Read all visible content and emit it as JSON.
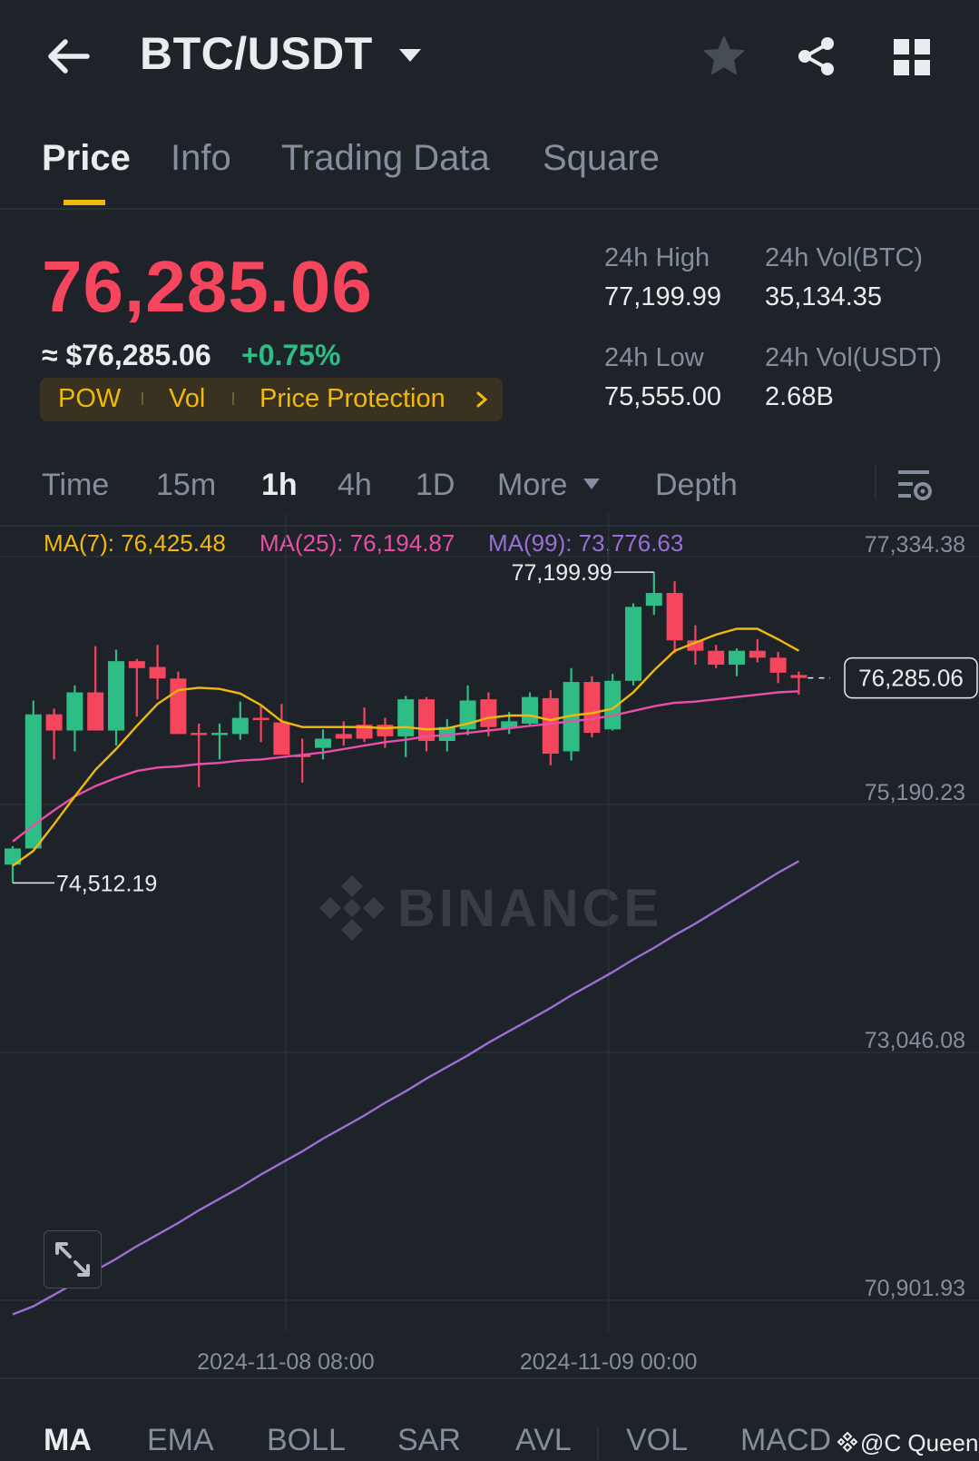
{
  "header": {
    "pair": "BTC/USDT",
    "icons": [
      "back-arrow-icon",
      "caret-down-icon",
      "star-icon",
      "share-icon",
      "grid-icon"
    ]
  },
  "tabs": [
    {
      "label": "Price",
      "active": true
    },
    {
      "label": "Info",
      "active": false
    },
    {
      "label": "Trading Data",
      "active": false
    },
    {
      "label": "Square",
      "active": false
    }
  ],
  "ticker": {
    "last_price": "76,285.06",
    "approx_usd": "≈ $76,285.06",
    "change_pct": "+0.75%",
    "tags": [
      "POW",
      "Vol",
      "Price Protection"
    ],
    "stats": {
      "high_label": "24h High",
      "high_value": "77,199.99",
      "low_label": "24h Low",
      "low_value": "75,555.00",
      "vol_btc_label": "24h Vol(BTC)",
      "vol_btc_value": "35,134.35",
      "vol_usdt_label": "24h Vol(USDT)",
      "vol_usdt_value": "2.68B"
    }
  },
  "intervals": {
    "items": [
      "Time",
      "15m",
      "1h",
      "4h",
      "1D",
      "More",
      "Depth"
    ],
    "active": "1h"
  },
  "ma_legend": {
    "ma7": "MA(7): 76,425.48",
    "ma25": "MA(25): 76,194.87",
    "ma99": "MA(99): 73,776.63"
  },
  "chart": {
    "watermark": "BINANCE",
    "expand_icon": "expand-arrows-icon",
    "settings_icon": "chart-settings-icon"
  },
  "chart_data": {
    "type": "candlestick",
    "interval": "1h",
    "y_ticks": [
      "77,334.38",
      "75,190.23",
      "73,046.08",
      "70,901.93"
    ],
    "y_range": [
      70901.93,
      77334.38
    ],
    "x_ticks": [
      "2024-11-08 08:00",
      "2024-11-09 00:00"
    ],
    "current_price_label": "76,285.06",
    "high_label": "77,199.99",
    "low_label": "74,512.19",
    "candles": [
      {
        "o": 74670,
        "h": 74830,
        "l": 74512,
        "c": 74810
      },
      {
        "o": 74810,
        "h": 76090,
        "l": 74830,
        "c": 75970
      },
      {
        "o": 75970,
        "h": 76020,
        "l": 75580,
        "c": 75830
      },
      {
        "o": 75830,
        "h": 76220,
        "l": 75650,
        "c": 76160
      },
      {
        "o": 76160,
        "h": 76560,
        "l": 75900,
        "c": 75830
      },
      {
        "o": 75830,
        "h": 76530,
        "l": 75700,
        "c": 76430
      },
      {
        "o": 76430,
        "h": 76450,
        "l": 75950,
        "c": 76370
      },
      {
        "o": 76380,
        "h": 76570,
        "l": 76100,
        "c": 76280
      },
      {
        "o": 76280,
        "h": 76340,
        "l": 75830,
        "c": 75800
      },
      {
        "o": 75810,
        "h": 75890,
        "l": 75340,
        "c": 75800
      },
      {
        "o": 75810,
        "h": 75890,
        "l": 75580,
        "c": 75810
      },
      {
        "o": 75800,
        "h": 76080,
        "l": 75750,
        "c": 75940
      },
      {
        "o": 75940,
        "h": 76050,
        "l": 75730,
        "c": 75920
      },
      {
        "o": 75900,
        "h": 76060,
        "l": 75640,
        "c": 75620
      },
      {
        "o": 75620,
        "h": 75760,
        "l": 75380,
        "c": 75610
      },
      {
        "o": 75680,
        "h": 75840,
        "l": 75580,
        "c": 75760
      },
      {
        "o": 75800,
        "h": 75910,
        "l": 75700,
        "c": 75760
      },
      {
        "o": 75880,
        "h": 76030,
        "l": 75730,
        "c": 75760
      },
      {
        "o": 75880,
        "h": 75940,
        "l": 75680,
        "c": 75780
      },
      {
        "o": 75780,
        "h": 76130,
        "l": 75600,
        "c": 76100
      },
      {
        "o": 76100,
        "h": 76120,
        "l": 75650,
        "c": 75740
      },
      {
        "o": 75740,
        "h": 75930,
        "l": 75650,
        "c": 75860
      },
      {
        "o": 75840,
        "h": 76220,
        "l": 75790,
        "c": 76090
      },
      {
        "o": 76100,
        "h": 76160,
        "l": 75780,
        "c": 75860
      },
      {
        "o": 75850,
        "h": 75990,
        "l": 75800,
        "c": 75910
      },
      {
        "o": 75890,
        "h": 76160,
        "l": 75870,
        "c": 76120
      },
      {
        "o": 76110,
        "h": 76180,
        "l": 75530,
        "c": 75630
      },
      {
        "o": 75650,
        "h": 76370,
        "l": 75570,
        "c": 76250
      },
      {
        "o": 76250,
        "h": 76300,
        "l": 75770,
        "c": 75810
      },
      {
        "o": 75840,
        "h": 76320,
        "l": 75830,
        "c": 76260
      },
      {
        "o": 76260,
        "h": 76930,
        "l": 76220,
        "c": 76900
      },
      {
        "o": 76910,
        "h": 77199.99,
        "l": 76830,
        "c": 77020
      },
      {
        "o": 77020,
        "h": 77120,
        "l": 76500,
        "c": 76610
      },
      {
        "o": 76610,
        "h": 76740,
        "l": 76400,
        "c": 76520
      },
      {
        "o": 76520,
        "h": 76570,
        "l": 76370,
        "c": 76400
      },
      {
        "o": 76400,
        "h": 76540,
        "l": 76300,
        "c": 76520
      },
      {
        "o": 76520,
        "h": 76620,
        "l": 76420,
        "c": 76460
      },
      {
        "o": 76460,
        "h": 76510,
        "l": 76240,
        "c": 76330
      },
      {
        "o": 76310,
        "h": 76340,
        "l": 76140,
        "c": 76285.06
      }
    ],
    "series": [
      {
        "name": "MA(7)",
        "color": "#f0b90b",
        "values": [
          74660,
          74790,
          75020,
          75260,
          75490,
          75670,
          75870,
          76060,
          76180,
          76200,
          76190,
          76150,
          76050,
          75910,
          75860,
          75860,
          75860,
          75860,
          75850,
          75860,
          75840,
          75850,
          75890,
          75940,
          75960,
          75960,
          75920,
          75960,
          75980,
          76020,
          76160,
          76350,
          76520,
          76590,
          76660,
          76710,
          76710,
          76620,
          76520
        ]
      },
      {
        "name": "MA(25)",
        "color": "#e84fa9",
        "values": [
          74870,
          75010,
          75140,
          75260,
          75350,
          75420,
          75480,
          75510,
          75520,
          75540,
          75550,
          75570,
          75580,
          75600,
          75620,
          75640,
          75670,
          75700,
          75730,
          75750,
          75780,
          75790,
          75810,
          75830,
          75850,
          75870,
          75890,
          75910,
          75930,
          75960,
          76000,
          76040,
          76070,
          76080,
          76100,
          76120,
          76140,
          76160,
          76170
        ]
      },
      {
        "name": "MA(99)",
        "color": "#9b6fd6",
        "values": [
          70780,
          70850,
          70950,
          71050,
          71160,
          71260,
          71370,
          71470,
          71570,
          71680,
          71780,
          71880,
          71990,
          72090,
          72190,
          72300,
          72400,
          72500,
          72610,
          72710,
          72820,
          72920,
          73020,
          73130,
          73230,
          73330,
          73430,
          73540,
          73640,
          73740,
          73850,
          73950,
          74060,
          74160,
          74270,
          74380,
          74490,
          74600,
          74700
        ]
      }
    ],
    "colors": {
      "up": "#2ebd85",
      "down": "#f6465d",
      "grid": "#2b3139"
    }
  },
  "indicators": {
    "items": [
      "MA",
      "EMA",
      "BOLL",
      "SAR",
      "AVL",
      "VOL",
      "MACD"
    ],
    "active": "MA"
  },
  "credit": "@C Queen"
}
